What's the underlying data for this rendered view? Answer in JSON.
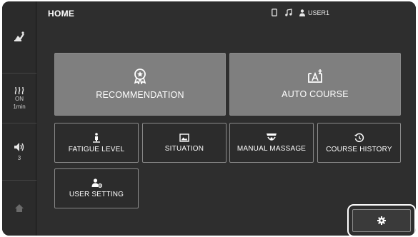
{
  "header": {
    "title": "HOME",
    "user_label": "USER1",
    "phone_icon": "phone-icon",
    "music_icon": "music-icon",
    "user_icon": "user-icon"
  },
  "sidebar": {
    "chair_icon": "chair-icon",
    "heat": {
      "icon": "heat-icon",
      "state": "ON",
      "duration": "1min"
    },
    "volume": {
      "icon": "speaker-icon",
      "level": "3"
    },
    "home_icon": "home-icon"
  },
  "tiles": {
    "recommendation": "RECOMMENDATION",
    "auto_course": "AUTO COURSE",
    "fatigue_level": "FATIGUE LEVEL",
    "situation": "SITUATION",
    "manual_massage": "MANUAL MASSAGE",
    "course_history": "COURSE HISTORY",
    "user_setting": "USER SETTING"
  },
  "settings_button": {
    "icon": "gear-icon"
  },
  "colors": {
    "background": "#2e2e2e",
    "tile_big": "#7f7f7f",
    "tile_border": "#8a8a8a",
    "text": "#ffffff"
  }
}
